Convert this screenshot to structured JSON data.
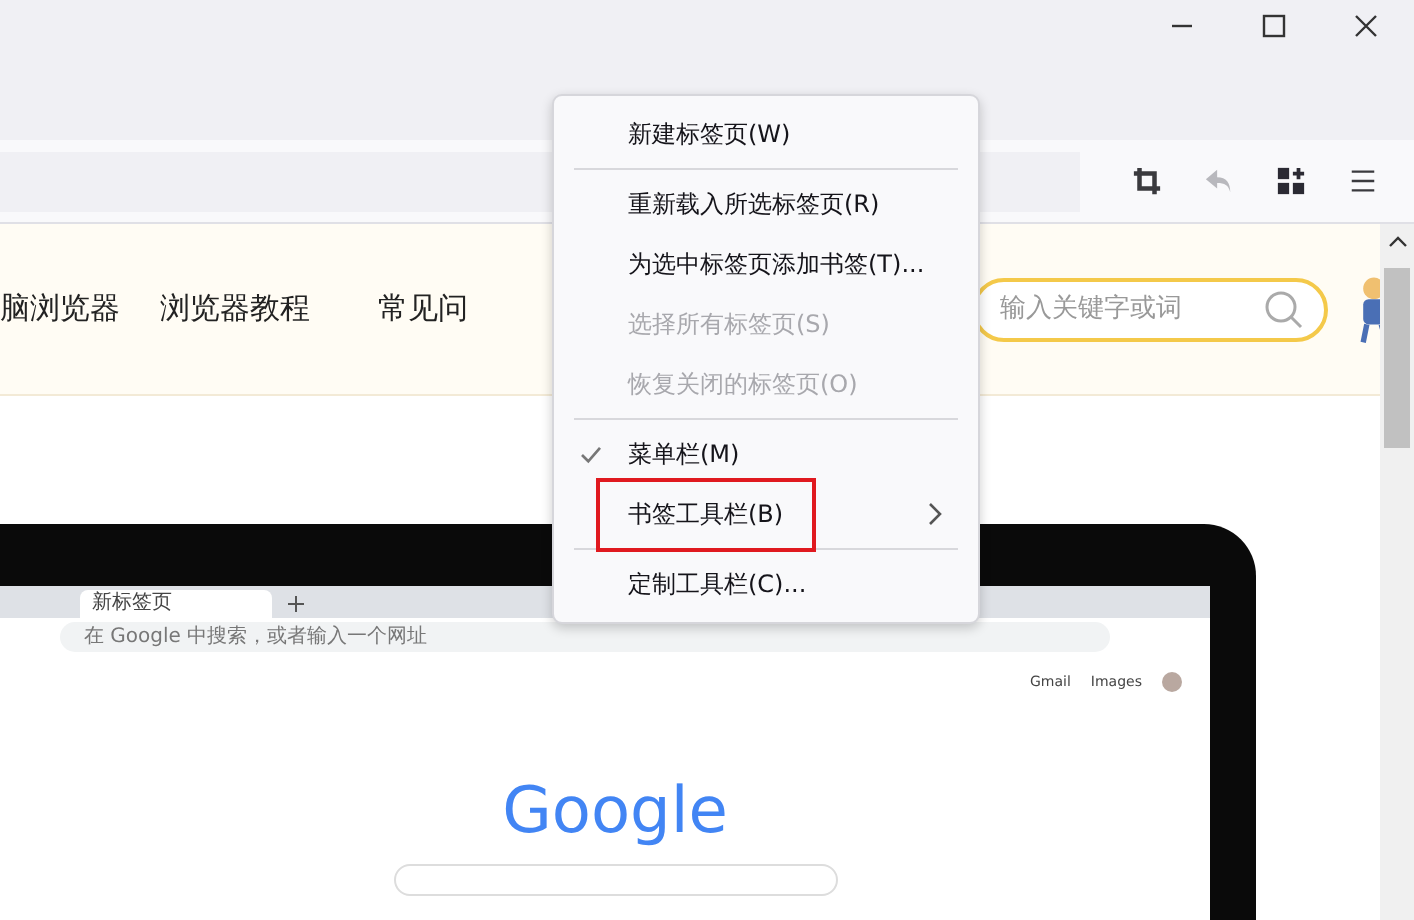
{
  "site_nav": {
    "links": [
      "脑浏览器",
      "浏览器教程",
      "常见问"
    ],
    "search": {
      "placeholder": "输入关键字或词"
    }
  },
  "embedded_browser": {
    "tab_title": "新标签页",
    "address_placeholder": "在 Google 中搜索，或者输入一个网址",
    "top_links": [
      "Gmail",
      "Images"
    ],
    "logo": "Google"
  },
  "context_menu": {
    "items": [
      {
        "kind": "item",
        "label": "新建标签页(W)",
        "disabled": false,
        "checked": false,
        "submenu": false,
        "highlighted": false
      },
      {
        "kind": "separator"
      },
      {
        "kind": "item",
        "label": "重新载入所选标签页(R)",
        "disabled": false,
        "checked": false,
        "submenu": false,
        "highlighted": false
      },
      {
        "kind": "item",
        "label": "为选中标签页添加书签(T)...",
        "disabled": false,
        "checked": false,
        "submenu": false,
        "highlighted": false
      },
      {
        "kind": "item",
        "label": "选择所有标签页(S)",
        "disabled": true,
        "checked": false,
        "submenu": false,
        "highlighted": false
      },
      {
        "kind": "item",
        "label": "恢复关闭的标签页(O)",
        "disabled": true,
        "checked": false,
        "submenu": false,
        "highlighted": false
      },
      {
        "kind": "separator"
      },
      {
        "kind": "item",
        "label": "菜单栏(M)",
        "disabled": false,
        "checked": true,
        "submenu": false,
        "highlighted": false
      },
      {
        "kind": "item",
        "label": "书签工具栏(B)",
        "disabled": false,
        "checked": false,
        "submenu": true,
        "highlighted": true
      },
      {
        "kind": "separator"
      },
      {
        "kind": "item",
        "label": "定制工具栏(C)...",
        "disabled": false,
        "checked": false,
        "submenu": false,
        "highlighted": false
      }
    ]
  }
}
